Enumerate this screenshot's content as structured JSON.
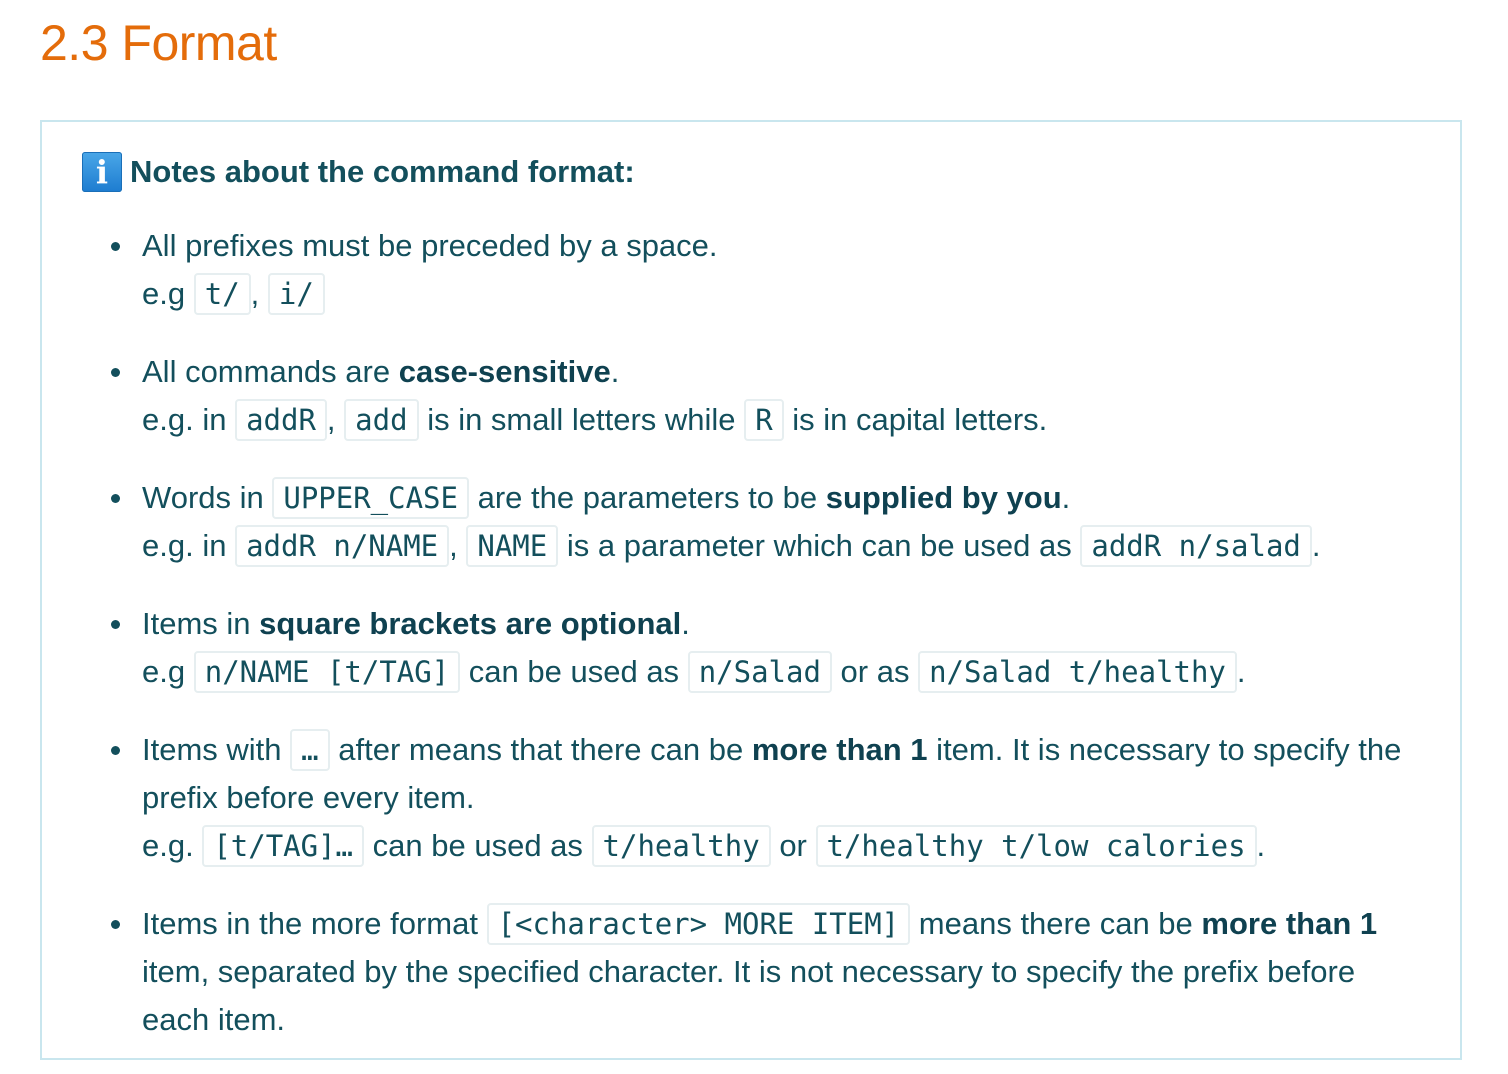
{
  "heading": "2.3 Format",
  "callout": {
    "icon": "info-icon",
    "title": "Notes about the command format:"
  },
  "notes": [
    {
      "line1": {
        "t1": "All prefixes must be preceded by a space."
      },
      "line2": {
        "t1": "e.g",
        "c1": "t/",
        "t2": ",",
        "c2": "i/"
      }
    },
    {
      "line1": {
        "t1": "All commands are ",
        "b1": "case-sensitive",
        "t2": "."
      },
      "line2": {
        "t1": "e.g. in",
        "c1": "addR",
        "t2": ",",
        "c2": "add",
        "t3": "is in small letters while",
        "c3": "R",
        "t4": "is in capital letters."
      }
    },
    {
      "line1": {
        "t1": "Words in",
        "c1": "UPPER_CASE",
        "t2": "are the parameters to be ",
        "b1": "supplied by you",
        "t3": "."
      },
      "line2": {
        "t1": "e.g. in",
        "c1": "addR n/NAME",
        "t2": ",",
        "c2": "NAME",
        "t3": "is a parameter which can be used as",
        "c3": "addR n/salad",
        "t4": "."
      }
    },
    {
      "line1": {
        "t1": "Items in ",
        "b1": "square brackets are optional",
        "t2": "."
      },
      "line2": {
        "t1": "e.g",
        "c1": "n/NAME [t/TAG]",
        "t2": "can be used as",
        "c2": "n/Salad",
        "t3": "or as",
        "c3": "n/Salad t/healthy",
        "t4": "."
      }
    },
    {
      "line1": {
        "t1": "Items with",
        "c1": "…",
        "t2": "after means that there can be ",
        "b1": "more than 1",
        "t3": " item. It is necessary to specify the prefix before every item."
      },
      "line2": {
        "t1": "e.g.",
        "c1": "[t/TAG]…",
        "t2": "can be used as",
        "c2": "t/healthy",
        "t3": "or",
        "c3": "t/healthy t/low calories",
        "t4": "."
      }
    },
    {
      "line1": {
        "t1": "Items in the more format",
        "c1": "[<character> MORE ITEM]",
        "t2": "means there can be ",
        "b1": "more than 1",
        "t3": " item, separated by the specified character. It is not necessary to specify the prefix before each item."
      }
    }
  ]
}
